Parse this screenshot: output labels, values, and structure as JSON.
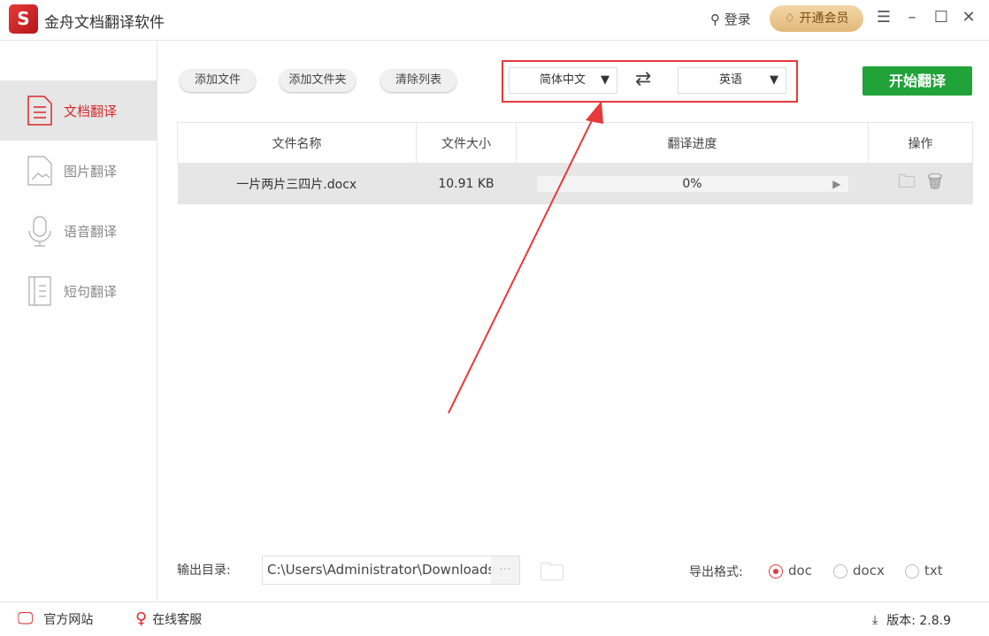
{
  "app": {
    "title": "金舟文档翻译软件",
    "login": "登录",
    "vip": "开通会员"
  },
  "sidebar": {
    "items": [
      {
        "label": "文档翻译"
      },
      {
        "label": "图片翻译"
      },
      {
        "label": "语音翻译"
      },
      {
        "label": "短句翻译"
      }
    ]
  },
  "toolbar": {
    "add_file": "添加文件",
    "add_folder": "添加文件夹",
    "clear_list": "清除列表",
    "source_lang": "简体中文",
    "target_lang": "英语",
    "start": "开始翻译"
  },
  "table": {
    "headers": [
      "文件名称",
      "文件大小",
      "翻译进度",
      "操作"
    ],
    "rows": [
      {
        "name": "一片两片三四片.docx",
        "size": "10.91 KB",
        "progress": "0%",
        "progress_value": 0
      }
    ]
  },
  "output": {
    "label": "输出目录:",
    "path": "C:\\Users\\Administrator\\Downloads",
    "browse": "···",
    "format_label": "导出格式:",
    "formats": [
      "doc",
      "docx",
      "txt"
    ],
    "selected_format": "doc"
  },
  "footer": {
    "website": "官方网站",
    "support": "在线客服",
    "version": "版本: 2.8.9"
  },
  "colors": {
    "accent": "#e8393a",
    "start": "#21a33a"
  }
}
